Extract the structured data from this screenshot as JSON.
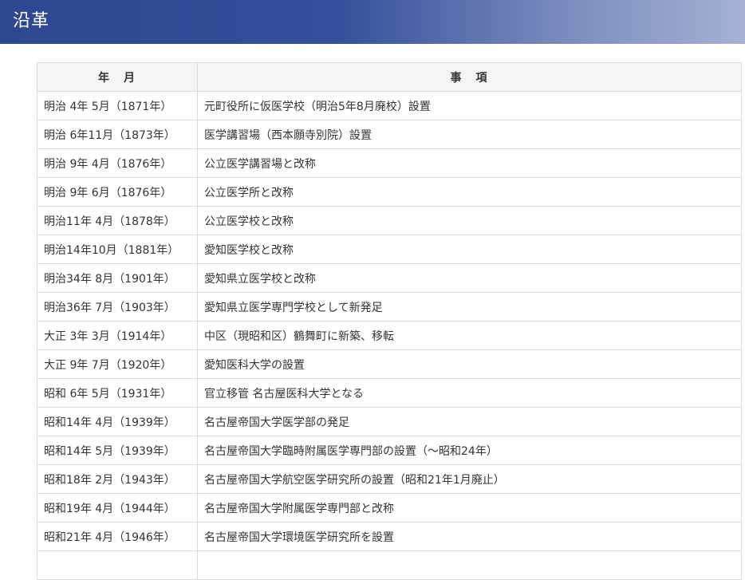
{
  "header": {
    "title": "沿革"
  },
  "table": {
    "columns": [
      "年　月",
      "事　項"
    ],
    "rows": [
      {
        "date": "明治 4年 5月（1871年）",
        "event": "元町役所に仮医学校（明治5年8月廃校）設置"
      },
      {
        "date": "明治 6年11月（1873年）",
        "event": "医学講習場（西本願寺別院）設置"
      },
      {
        "date": "明治 9年 4月（1876年）",
        "event": "公立医学講習場と改称"
      },
      {
        "date": "明治 9年 6月（1876年）",
        "event": "公立医学所と改称"
      },
      {
        "date": "明治11年 4月（1878年）",
        "event": "公立医学校と改称"
      },
      {
        "date": "明治14年10月（1881年）",
        "event": "愛知医学校と改称"
      },
      {
        "date": "明治34年 8月（1901年）",
        "event": "愛知県立医学校と改称"
      },
      {
        "date": "明治36年 7月（1903年）",
        "event": "愛知県立医学専門学校として新発足"
      },
      {
        "date": "大正 3年 3月（1914年）",
        "event": "中区（現昭和区）鶴舞町に新築、移転"
      },
      {
        "date": "大正 9年 7月（1920年）",
        "event": "愛知医科大学の設置"
      },
      {
        "date": "昭和 6年 5月（1931年）",
        "event": "官立移管 名古屋医科大学となる"
      },
      {
        "date": "昭和14年 4月（1939年）",
        "event": "名古屋帝国大学医学部の発足"
      },
      {
        "date": "昭和14年 5月（1939年）",
        "event": "名古屋帝国大学臨時附属医学専門部の設置（～昭和24年）"
      },
      {
        "date": "昭和18年 2月（1943年）",
        "event": "名古屋帝国大学航空医学研究所の設置（昭和21年1月廃止）"
      },
      {
        "date": "昭和19年 4月（1944年）",
        "event": "名古屋帝国大学附属医学専門部と改称"
      },
      {
        "date": "昭和21年 4月（1946年）",
        "event": "名古屋帝国大学環境医学研究所を設置"
      },
      {
        "date": "",
        "event": ""
      }
    ]
  }
}
